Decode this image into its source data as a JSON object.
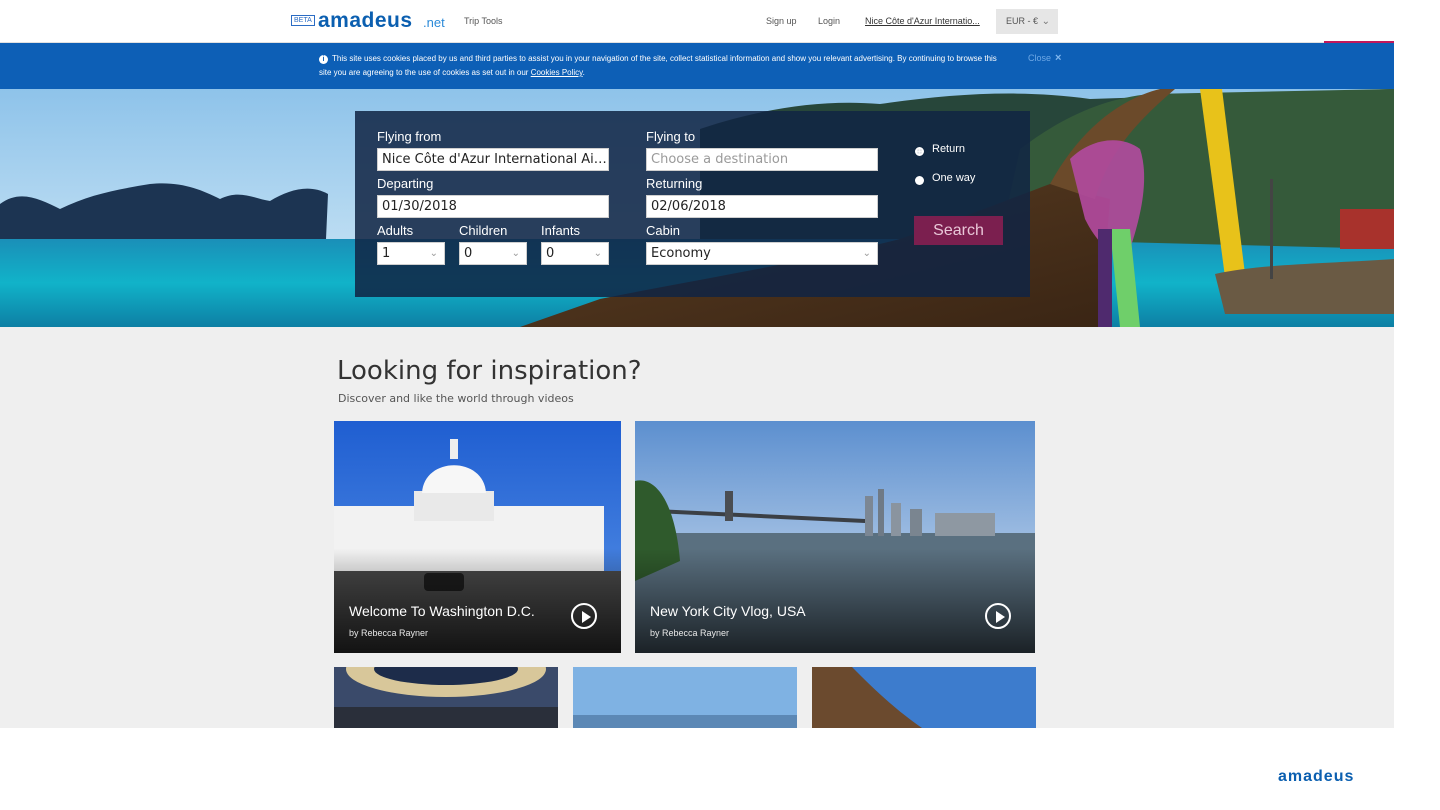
{
  "header": {
    "beta_badge": "BETA",
    "logo": "amadeus",
    "logo_suffix": ".net",
    "trip_tools": "Trip Tools",
    "sign_up": "Sign up",
    "login": "Login",
    "airport_link": "Nice Côte d'Azur Internatio...",
    "currency": "EUR - €",
    "currency_icon": "chevron-down-icon"
  },
  "cookie_banner": {
    "text": "This site uses cookies placed by us and third parties to assist you in your navigation of the site, collect statistical information and show you relevant advertising. By continuing to browse this site you are agreeing to the use of cookies as set out in our",
    "link": "Cookies Policy",
    "after_link": ".",
    "close_label": "Close",
    "close_icon": "×",
    "info_icon": "i"
  },
  "search": {
    "from_label": "Flying from",
    "from_value": "Nice Côte d'Azur International Air...",
    "to_label": "Flying to",
    "to_placeholder": "Choose a destination",
    "departing_label": "Departing",
    "departing_value": "01/30/2018",
    "returning_label": "Returning",
    "returning_value": "02/06/2018",
    "adults_label": "Adults",
    "adults_value": "1",
    "children_label": "Children",
    "children_value": "0",
    "infants_label": "Infants",
    "infants_value": "0",
    "cabin_label": "Cabin",
    "cabin_value": "Economy",
    "trip_types": [
      {
        "label": "Return",
        "selected": true
      },
      {
        "label": "One way",
        "selected": false
      }
    ],
    "search_button": "Search"
  },
  "inspiration": {
    "title": "Looking for inspiration?",
    "subtitle": "Discover and like the world through videos",
    "videos": [
      {
        "title": "Welcome To Washington D.C.",
        "author": "by Rebecca Rayner"
      },
      {
        "title": "New York City Vlog, USA",
        "author": "by Rebecca Rayner"
      }
    ]
  },
  "footer": {
    "brand": "amadeus"
  },
  "colors": {
    "brand_blue": "#0b5fb0",
    "banner_blue": "#0d5fb6",
    "search_button": "#7b1f4f",
    "panel": "#102444"
  }
}
